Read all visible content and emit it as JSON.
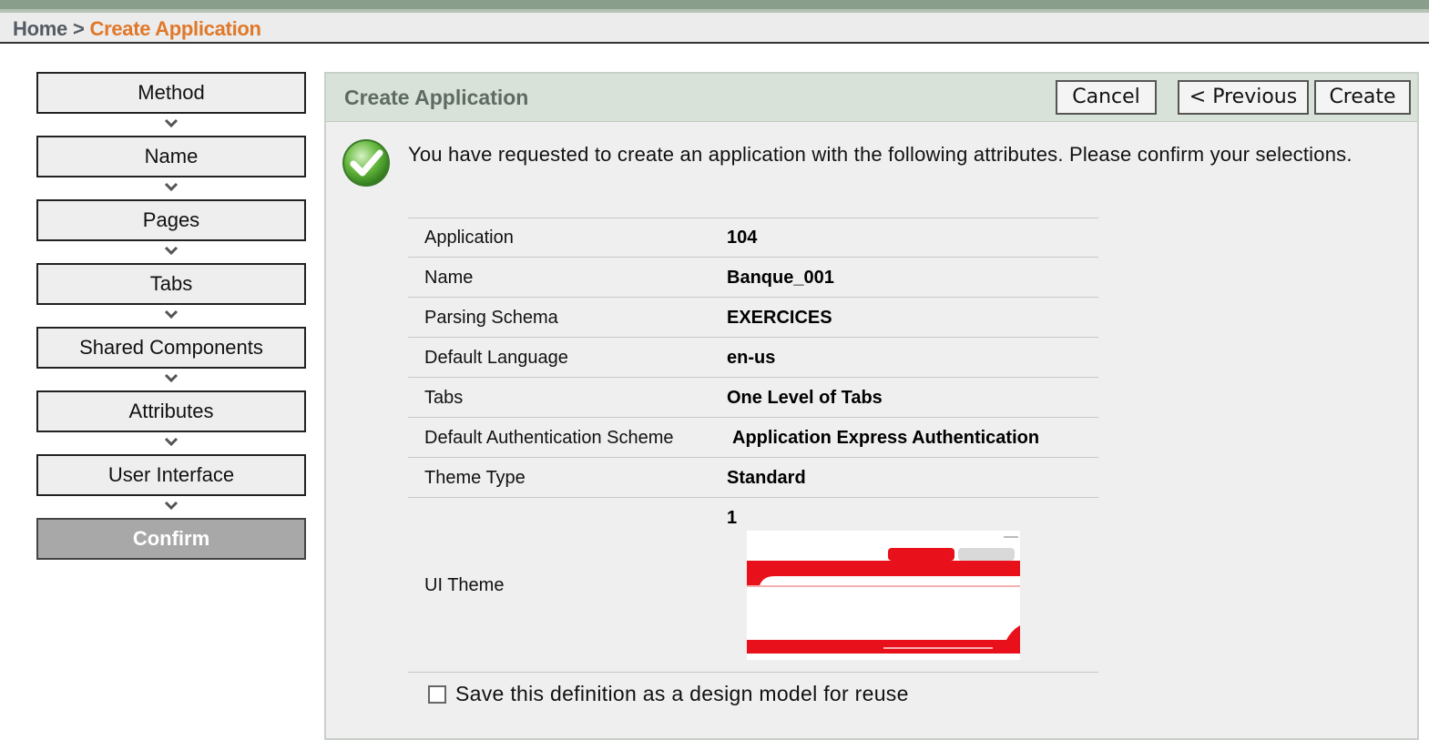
{
  "breadcrumb": {
    "home": "Home",
    "separator": ">",
    "current": "Create Application"
  },
  "steps": [
    {
      "label": "Method"
    },
    {
      "label": "Name"
    },
    {
      "label": "Pages"
    },
    {
      "label": "Tabs"
    },
    {
      "label": "Shared Components"
    },
    {
      "label": "Attributes"
    },
    {
      "label": "User Interface"
    },
    {
      "label": "Confirm",
      "active": true
    }
  ],
  "panel": {
    "title": "Create Application",
    "buttons": {
      "cancel": "Cancel",
      "previous": "< Previous",
      "create": "Create"
    },
    "intro": "You have requested to create an application with the following attributes. Please confirm your selections.",
    "attributes": [
      {
        "label": "Application",
        "value": "104"
      },
      {
        "label": "Name",
        "value": "Banque_001"
      },
      {
        "label": "Parsing Schema",
        "value": "EXERCICES"
      },
      {
        "label": "Default Language",
        "value": "en-us"
      },
      {
        "label": "Tabs",
        "value": "One Level of Tabs"
      },
      {
        "label": "Default Authentication Scheme",
        "value": "Application Express Authentication"
      },
      {
        "label": "Theme Type",
        "value": "Standard"
      },
      {
        "label": "UI Theme",
        "value": "1"
      }
    ],
    "save_label": "Save this definition as a design model for reuse"
  },
  "colors": {
    "accent": "#e0782a",
    "theme_red": "#e8101a",
    "header_bg": "#d9e2d9"
  }
}
